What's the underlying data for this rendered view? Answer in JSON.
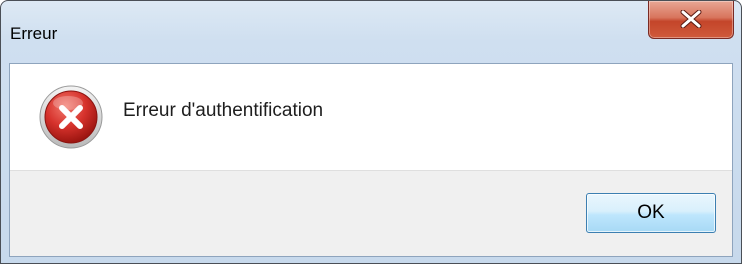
{
  "window": {
    "title": "Erreur"
  },
  "close_button": {
    "icon": "close-icon",
    "color": "#c4452a"
  },
  "message": {
    "icon": "error-icon",
    "icon_color": "#d12b2b",
    "text": "Erreur d'authentification"
  },
  "buttons": {
    "ok_label": "OK"
  }
}
